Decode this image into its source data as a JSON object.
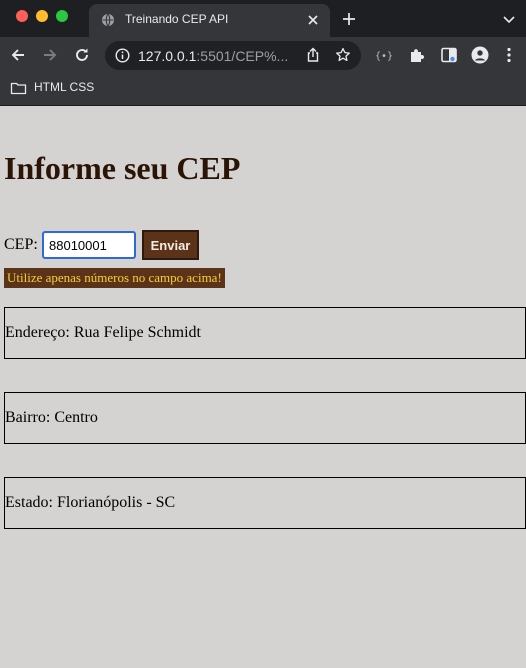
{
  "browser": {
    "tab_title": "Treinando CEP API",
    "url_host": "127.0.0.1",
    "url_rest": ":5501/CEP%...",
    "bookmarks": [
      {
        "label": "HTML CSS"
      }
    ]
  },
  "page": {
    "heading": "Informe seu CEP",
    "cep_label": "CEP:",
    "cep_value": "88010001",
    "submit_label": "Enviar",
    "warning": "Utilize apenas números no campo acima!",
    "results": {
      "endereco": "Endereço: Rua Felipe Schmidt",
      "bairro": "Bairro: Centro",
      "estado": "Estado: Florianópolis - SC"
    }
  },
  "colors": {
    "page_background": "#d4d3d2",
    "heading": "#2b1306",
    "button_background": "#5b3318",
    "warning_text": "#f4d13a",
    "input_border": "#2d6ad7"
  }
}
